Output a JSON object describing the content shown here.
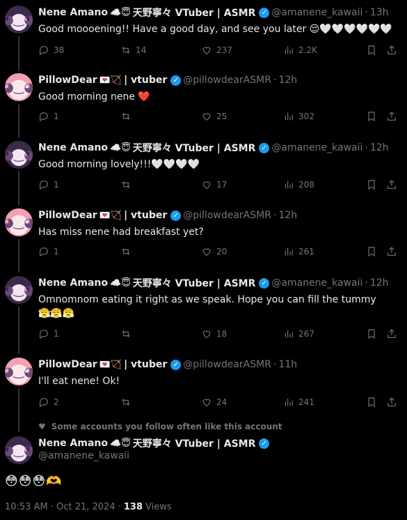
{
  "tweets": [
    {
      "name": "Nene Amano",
      "name_emoji": "☁️😇",
      "jp": "天野寧々 VTuber | ASMR",
      "handle": "@amanene_kawaii",
      "sep": "·",
      "time": "13h",
      "text": "Good moooening!! Have a good day, and see you later 😌🤍🤍🤍🤍🤍🤍",
      "replies": "38",
      "retweets": "14",
      "likes": "237",
      "views": "2.2K"
    },
    {
      "name": "PillowDear",
      "name_emoji": "💌🏹",
      "jp": "| vtuber",
      "handle": "@pillowdearASMR",
      "sep": "·",
      "time": "12h",
      "text": "Good morning nene ❤️",
      "replies": "1",
      "retweets": "",
      "likes": "25",
      "views": "302"
    },
    {
      "name": "Nene Amano",
      "name_emoji": "☁️😇",
      "jp": "天野寧々 VTuber | ASMR",
      "handle": "@amanene_kawaii",
      "sep": "·",
      "time": "12h",
      "text": "Good morning lovely!!!🤍🤍🤍🤍",
      "replies": "1",
      "retweets": "",
      "likes": "17",
      "views": "208"
    },
    {
      "name": "PillowDear",
      "name_emoji": "💌🏹",
      "jp": "| vtuber",
      "handle": "@pillowdearASMR",
      "sep": "·",
      "time": "12h",
      "text": "Has miss nene had breakfast yet?",
      "replies": "1",
      "retweets": "",
      "likes": "20",
      "views": "261"
    },
    {
      "name": "Nene Amano",
      "name_emoji": "☁️😇",
      "jp": "天野寧々 VTuber | ASMR",
      "handle": "@amanene_kawaii",
      "sep": "·",
      "time": "12h",
      "text": "Omnomnom eating it right as we speak. Hope you can fill the tummy too!!",
      "text2": "😤😤😤",
      "replies": "1",
      "retweets": "",
      "likes": "18",
      "views": "267"
    },
    {
      "name": "PillowDear",
      "name_emoji": "💌🏹",
      "jp": "| vtuber",
      "handle": "@pillowdearASMR",
      "sep": "·",
      "time": "11h",
      "text": "I'll eat nene! Ok!",
      "replies": "2",
      "retweets": "",
      "likes": "24",
      "views": "241"
    }
  ],
  "social_context": "Some accounts you follow often like this account",
  "main": {
    "name": "Nene Amano",
    "name_emoji": "☁️😇",
    "jp": "天野寧々 VTuber | ASMR",
    "handle": "@amanene_kawaii",
    "text": "😳😳😳🫶",
    "time": "10:53 AM · Oct 21, 2024 ·",
    "views_count": "138",
    "views_label": "Views"
  },
  "colors": {
    "verified": "#1d9bf0",
    "muted": "#71767b",
    "text": "#e7e9ea"
  }
}
